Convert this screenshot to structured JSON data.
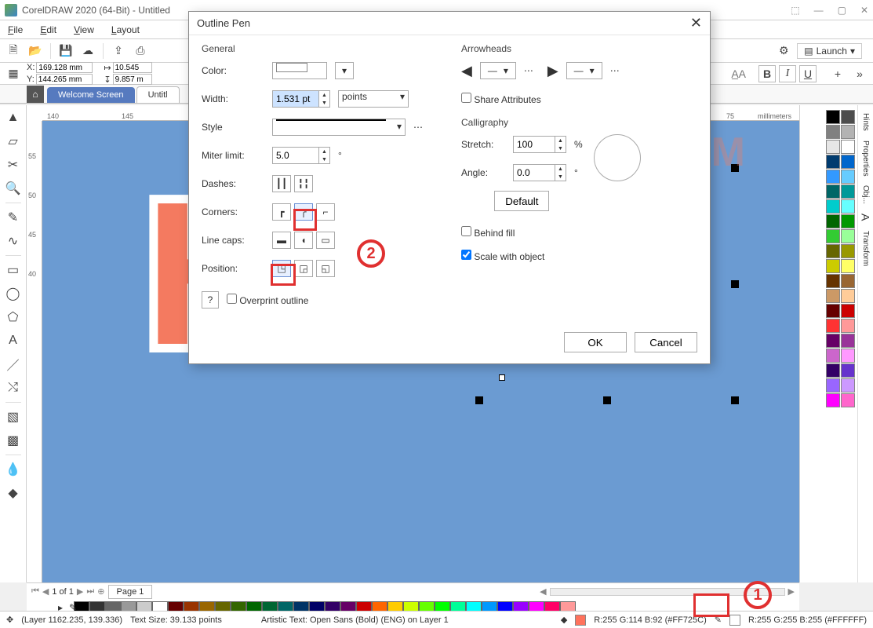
{
  "app": {
    "title": "CorelDRAW 2020 (64-Bit) - Untitled"
  },
  "menu": {
    "file": "File",
    "edit": "Edit",
    "view": "View",
    "layout": "Layout"
  },
  "launch": "Launch",
  "coords": {
    "x": "169.128 mm",
    "y": "144.265 mm",
    "w": "10.545",
    "h": "9.857 m"
  },
  "tabs": {
    "welcome": "Welcome Screen",
    "untitled": "Untitl"
  },
  "ruler_h": {
    "a": "140",
    "b": "145",
    "unit": "millimeters",
    "c": "75"
  },
  "ruler_v": {
    "a": "55",
    "b": "50",
    "c": "45",
    "d": "40"
  },
  "watermark": "ZOTUTORIAL.COM",
  "pagebar": {
    "pos": "1 of 1",
    "page": "Page 1"
  },
  "dialog": {
    "title": "Outline Pen",
    "general": "General",
    "color_lbl": "Color:",
    "width_lbl": "Width:",
    "width_val": "1.531 pt",
    "width_unit": "points",
    "style_lbl": "Style",
    "miter_lbl": "Miter limit:",
    "miter_val": "5.0",
    "miter_deg": "°",
    "dashes_lbl": "Dashes:",
    "corners_lbl": "Corners:",
    "caps_lbl": "Line caps:",
    "position_lbl": "Position:",
    "overprint": "Overprint outline",
    "arrowheads": "Arrowheads",
    "share": "Share Attributes",
    "calligraphy": "Calligraphy",
    "stretch_lbl": "Stretch:",
    "stretch_val": "100",
    "pct": "%",
    "angle_lbl": "Angle:",
    "angle_val": "0.0",
    "default": "Default",
    "behind": "Behind fill",
    "scale": "Scale with object",
    "ok": "OK",
    "cancel": "Cancel"
  },
  "status": {
    "layer": "(Layer 1162.235, 139.336)",
    "textsize": "Text Size: 39.133 points",
    "artistic": "Artistic Text: Open Sans (Bold) (ENG) on Layer 1",
    "fill": "R:255 G:114 B:92 (#FF725C)",
    "outline": "R:255 G:255 B:255 (#FFFFFF)"
  },
  "right_tabs": {
    "hints": "Hints",
    "props": "Properties",
    "obj": "Obj...",
    "transform": "Transform"
  },
  "palette_colors": [
    "#000000",
    "#4d4d4d",
    "#808080",
    "#b3b3b3",
    "#e6e6e6",
    "#ffffff",
    "#003b6f",
    "#0066cc",
    "#3399ff",
    "#66ccff",
    "#006666",
    "#009999",
    "#00cccc",
    "#66ffff",
    "#006600",
    "#009900",
    "#33cc33",
    "#99ff99",
    "#666600",
    "#999900",
    "#cccc00",
    "#ffff66",
    "#663300",
    "#996633",
    "#cc9966",
    "#ffcc99",
    "#660000",
    "#cc0000",
    "#ff3333",
    "#ff9999",
    "#660066",
    "#993399",
    "#cc66cc",
    "#ff99ff",
    "#330066",
    "#6633cc",
    "#9966ff",
    "#cc99ff",
    "#ff00ff",
    "#ff66cc"
  ],
  "colorbar": [
    "#000000",
    "#333333",
    "#666666",
    "#999999",
    "#cccccc",
    "#ffffff",
    "#660000",
    "#993300",
    "#996600",
    "#666600",
    "#336600",
    "#006600",
    "#006633",
    "#006666",
    "#003366",
    "#000066",
    "#330066",
    "#660066",
    "#cc0000",
    "#ff6600",
    "#ffcc00",
    "#ccff00",
    "#66ff00",
    "#00ff00",
    "#00ff99",
    "#00ffff",
    "#0099ff",
    "#0000ff",
    "#9900ff",
    "#ff00ff",
    "#ff0066",
    "#ff9999"
  ],
  "annot": {
    "one": "1",
    "two": "2"
  },
  "text_style": {
    "B": "B",
    "I": "I",
    "U": "U"
  }
}
